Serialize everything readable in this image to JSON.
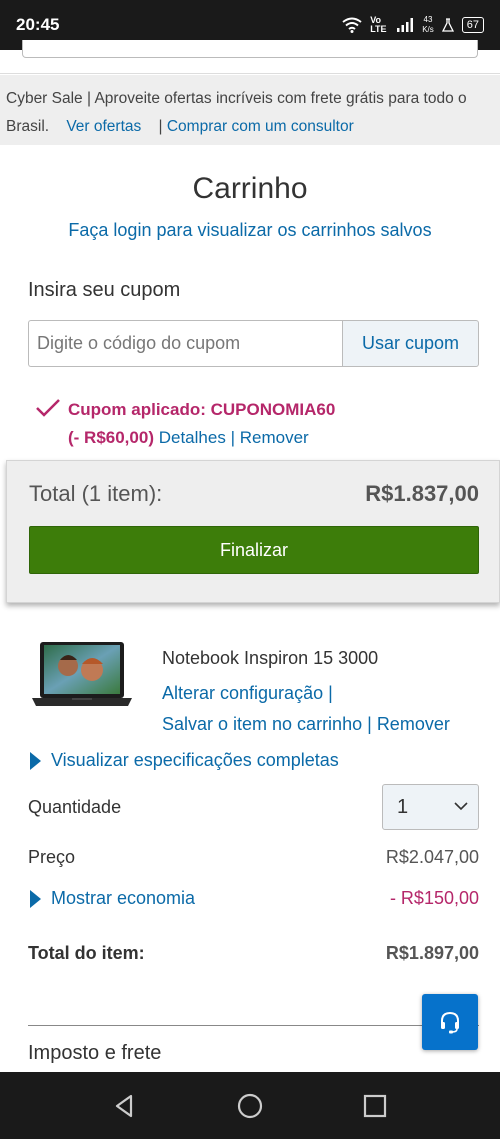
{
  "status_bar": {
    "time": "20:45",
    "network": "Vo LTE",
    "speed_top": "43",
    "speed_bottom": "K/s",
    "battery": "67",
    "icons": [
      "wifi-icon",
      "signal-icon",
      "battery-icon"
    ]
  },
  "banner": {
    "text": "Cyber Sale | Aproveite ofertas incríveis com frete grátis para todo o Brasil.",
    "link_offers": "Ver ofertas",
    "separator": "|",
    "link_consultant": "Comprar com um consultor"
  },
  "cart": {
    "title": "Carrinho",
    "login_link": "Faça login para visualizar os carrinhos salvos"
  },
  "coupon": {
    "label": "Insira seu cupom",
    "placeholder": "Digite o código do cupom",
    "value": "",
    "button": "Usar cupom",
    "applied_text": "Cupom aplicado: CUPONOMIA60",
    "discount": "(- R$60,00)",
    "details_link": "Detalhes",
    "separator": "|",
    "remove_link": "Remover"
  },
  "summary": {
    "total_label": "Total (1 item):",
    "total_value": "R$1.837,00",
    "checkout_button": "Finalizar"
  },
  "item": {
    "name": "Notebook Inspiron 15 3000",
    "change_config": "Alterar configuração |",
    "save_item": "Salvar o item no carrinho",
    "separator": "|",
    "remove": "Remover",
    "specs_link": "Visualizar especificações completas",
    "quantity_label": "Quantidade",
    "quantity_value": "1",
    "price_label": "Preço",
    "price_value": "R$2.047,00",
    "savings_link": "Mostrar economia",
    "savings_value": "- R$150,00",
    "item_total_label": "Total do item:",
    "item_total_value": "R$1.897,00"
  },
  "shipping": {
    "label": "Imposto e frete"
  },
  "colors": {
    "link": "#0b6aa8",
    "accent_magenta": "#b5276a",
    "checkout_green": "#3d7d0a",
    "chat_blue": "#0672cb"
  }
}
